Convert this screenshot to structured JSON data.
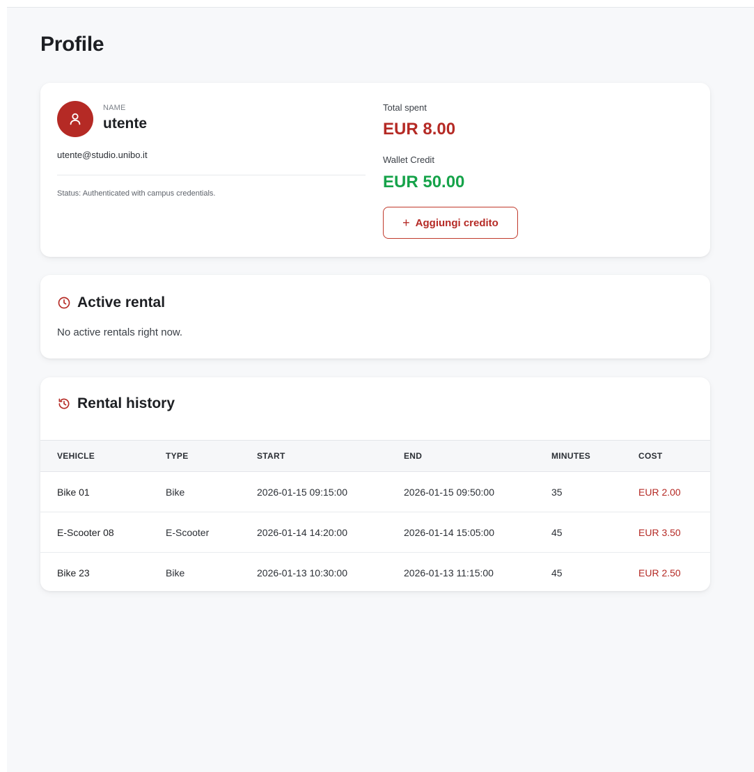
{
  "page": {
    "title": "Profile"
  },
  "profile": {
    "name_label": "NAME",
    "name": "utente",
    "email": "utente@studio.unibo.it",
    "status": "Status: Authenticated with campus credentials.",
    "total_spent_label": "Total spent",
    "total_spent": "EUR 8.00",
    "wallet_label": "Wallet Credit",
    "wallet_credit": "EUR 50.00",
    "add_credit_button": "Aggiungi credito",
    "add_credit_icon": "+"
  },
  "active_rental": {
    "title": "Active rental",
    "empty_message": "No active rentals right now."
  },
  "rental_history": {
    "title": "Rental history",
    "columns": [
      "VEHICLE",
      "TYPE",
      "START",
      "END",
      "MINUTES",
      "COST"
    ],
    "rows": [
      {
        "vehicle": "Bike 01",
        "type": "Bike",
        "start": "2026-01-15 09:15:00",
        "end": "2026-01-15 09:50:00",
        "minutes": "35",
        "cost": "EUR 2.00"
      },
      {
        "vehicle": "E-Scooter 08",
        "type": "E-Scooter",
        "start": "2026-01-14 14:20:00",
        "end": "2026-01-14 15:05:00",
        "minutes": "45",
        "cost": "EUR 3.50"
      },
      {
        "vehicle": "Bike 23",
        "type": "Bike",
        "start": "2026-01-13 10:30:00",
        "end": "2026-01-13 11:15:00",
        "minutes": "45",
        "cost": "EUR 2.50"
      }
    ]
  },
  "icons": {
    "avatar": "user-icon",
    "active_rental": "clock-icon",
    "rental_history": "history-icon"
  },
  "colors": {
    "accent": "#b52a25",
    "credit": "#16a34a",
    "background": "#f7f8fa"
  }
}
